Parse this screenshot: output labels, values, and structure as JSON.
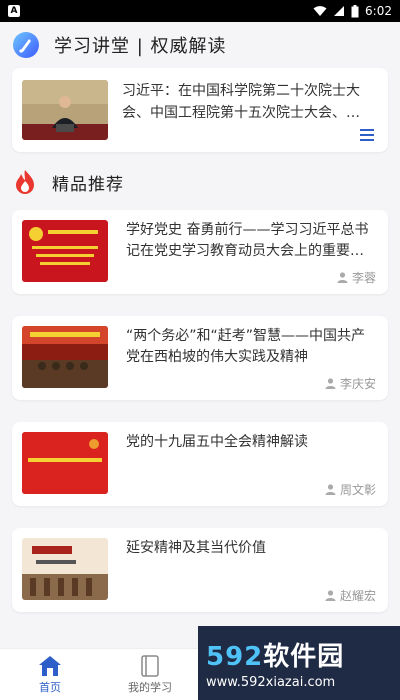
{
  "status_bar": {
    "time": "6:02",
    "left_icon": "A"
  },
  "lecture_section": {
    "title": "学习讲堂 | 权威解读",
    "card": {
      "text": "习近平：在中国科学院第二十次院士大会、中国工程院第十五次院士大会、…"
    }
  },
  "recommend_section": {
    "title": "精品推荐",
    "items": [
      {
        "title": "学好党史 奋勇前行——学习习近平总书记在党史学习教育动员大会上的重要…",
        "author": "李蓉"
      },
      {
        "title": "“两个务必”和“赶考”智慧——中国共产党在西柏坡的伟大实践及精神",
        "author": "李庆安"
      },
      {
        "title": "党的十九届五中全会精神解读",
        "author": "周文彰"
      },
      {
        "title": "延安精神及其当代价值",
        "author": "赵耀宏"
      }
    ]
  },
  "bottom_nav": {
    "home": "首页",
    "my_study": "我的学习"
  },
  "watermark": {
    "brand_num": "592",
    "brand_text": "软件园",
    "url": "www.592xiazai.com"
  },
  "colors": {
    "accent": "#2e5fc9",
    "party_red": "#c9151e"
  }
}
